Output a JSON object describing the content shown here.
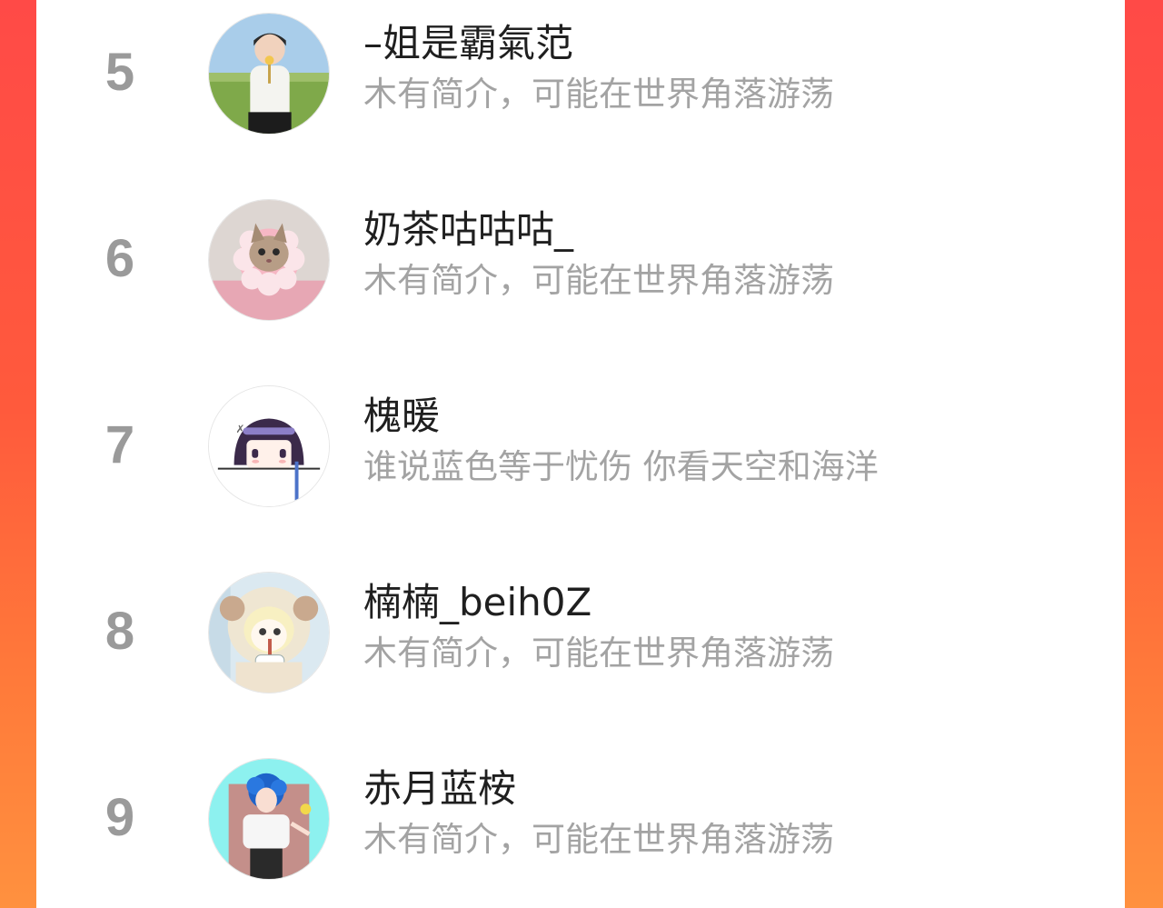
{
  "colors": {
    "background_top": "#ff4a47",
    "background_bottom": "#ff913f",
    "panel": "#ffffff",
    "rank_text": "#9a9a9a",
    "name_text": "#1f1f1f",
    "bio_text": "#a3a3a3"
  },
  "ranking": {
    "items": [
      {
        "rank": "5",
        "name": "–姐是霸氣范",
        "bio": "木有简介，可能在世界角落游荡",
        "avatar_icon": "man-in-field-avatar"
      },
      {
        "rank": "6",
        "name": "奶茶咕咕咕_",
        "bio": "木有简介，可能在世界角落游荡",
        "avatar_icon": "cat-flower-collar-avatar"
      },
      {
        "rank": "7",
        "name": "槐暖",
        "bio": "谁说蓝色等于忧伤 你看天空和海洋",
        "avatar_icon": "chibi-girl-avatar"
      },
      {
        "rank": "8",
        "name": "楠楠_beih0Z",
        "bio": "木有简介，可能在世界角落游荡",
        "avatar_icon": "sheep-girl-avatar"
      },
      {
        "rank": "9",
        "name": "赤月蓝桉",
        "bio": "木有简介，可能在世界角落游荡",
        "avatar_icon": "blue-hair-girl-avatar"
      }
    ]
  }
}
